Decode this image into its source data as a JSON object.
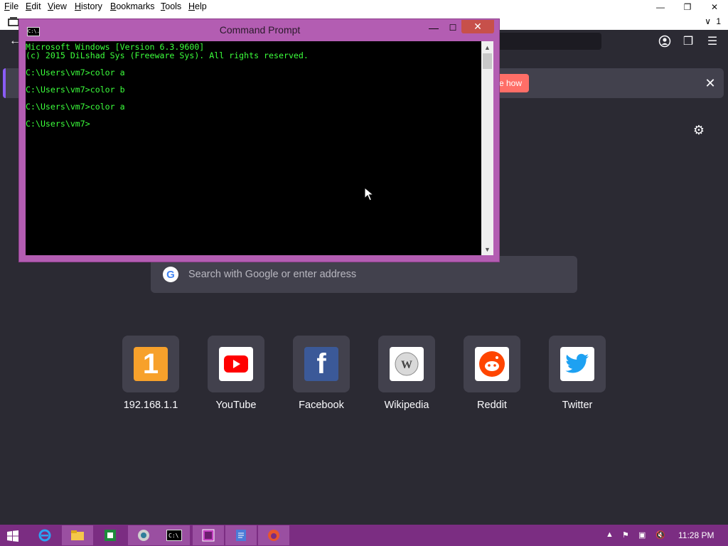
{
  "browser": {
    "menu": [
      "File",
      "Edit",
      "View",
      "History",
      "Bookmarks",
      "Tools",
      "Help"
    ],
    "tab_count": "1",
    "notification_button": "e how",
    "search_placeholder": "Search with Google or enter address",
    "top_sites": [
      {
        "label": "192.168.1.1",
        "icon": "number-one-icon",
        "color": "#f7a12b"
      },
      {
        "label": "YouTube",
        "icon": "youtube-play-icon",
        "color": "#ff0000"
      },
      {
        "label": "Facebook",
        "icon": "facebook-f-icon",
        "color": "#3b5998"
      },
      {
        "label": "Wikipedia",
        "icon": "wikipedia-globe-icon",
        "color": "#eeeeee"
      },
      {
        "label": "Reddit",
        "icon": "reddit-alien-icon",
        "color": "#ff4500"
      },
      {
        "label": "Twitter",
        "icon": "twitter-bird-icon",
        "color": "#1da1f2"
      }
    ]
  },
  "cmd": {
    "title": "Command Prompt",
    "icon_text": "C:\\.",
    "lines": [
      "Microsoft Windows [Version 6.3.9600]",
      "(c) 2015 DiLshad Sys (Freeware Sys). All rights reserved.",
      "",
      "C:\\Users\\vm7>color a",
      "",
      "C:\\Users\\vm7>color b",
      "",
      "C:\\Users\\vm7>color a",
      "",
      "C:\\Users\\vm7>"
    ]
  },
  "taskbar": {
    "clock": "11:28 PM"
  },
  "colors": {
    "console_text": "#3cff3c",
    "cmd_frame": "#b35db2",
    "taskbar": "#7b2d82",
    "page_bg": "#2b2a33",
    "notification_button": "#ff6e67"
  }
}
